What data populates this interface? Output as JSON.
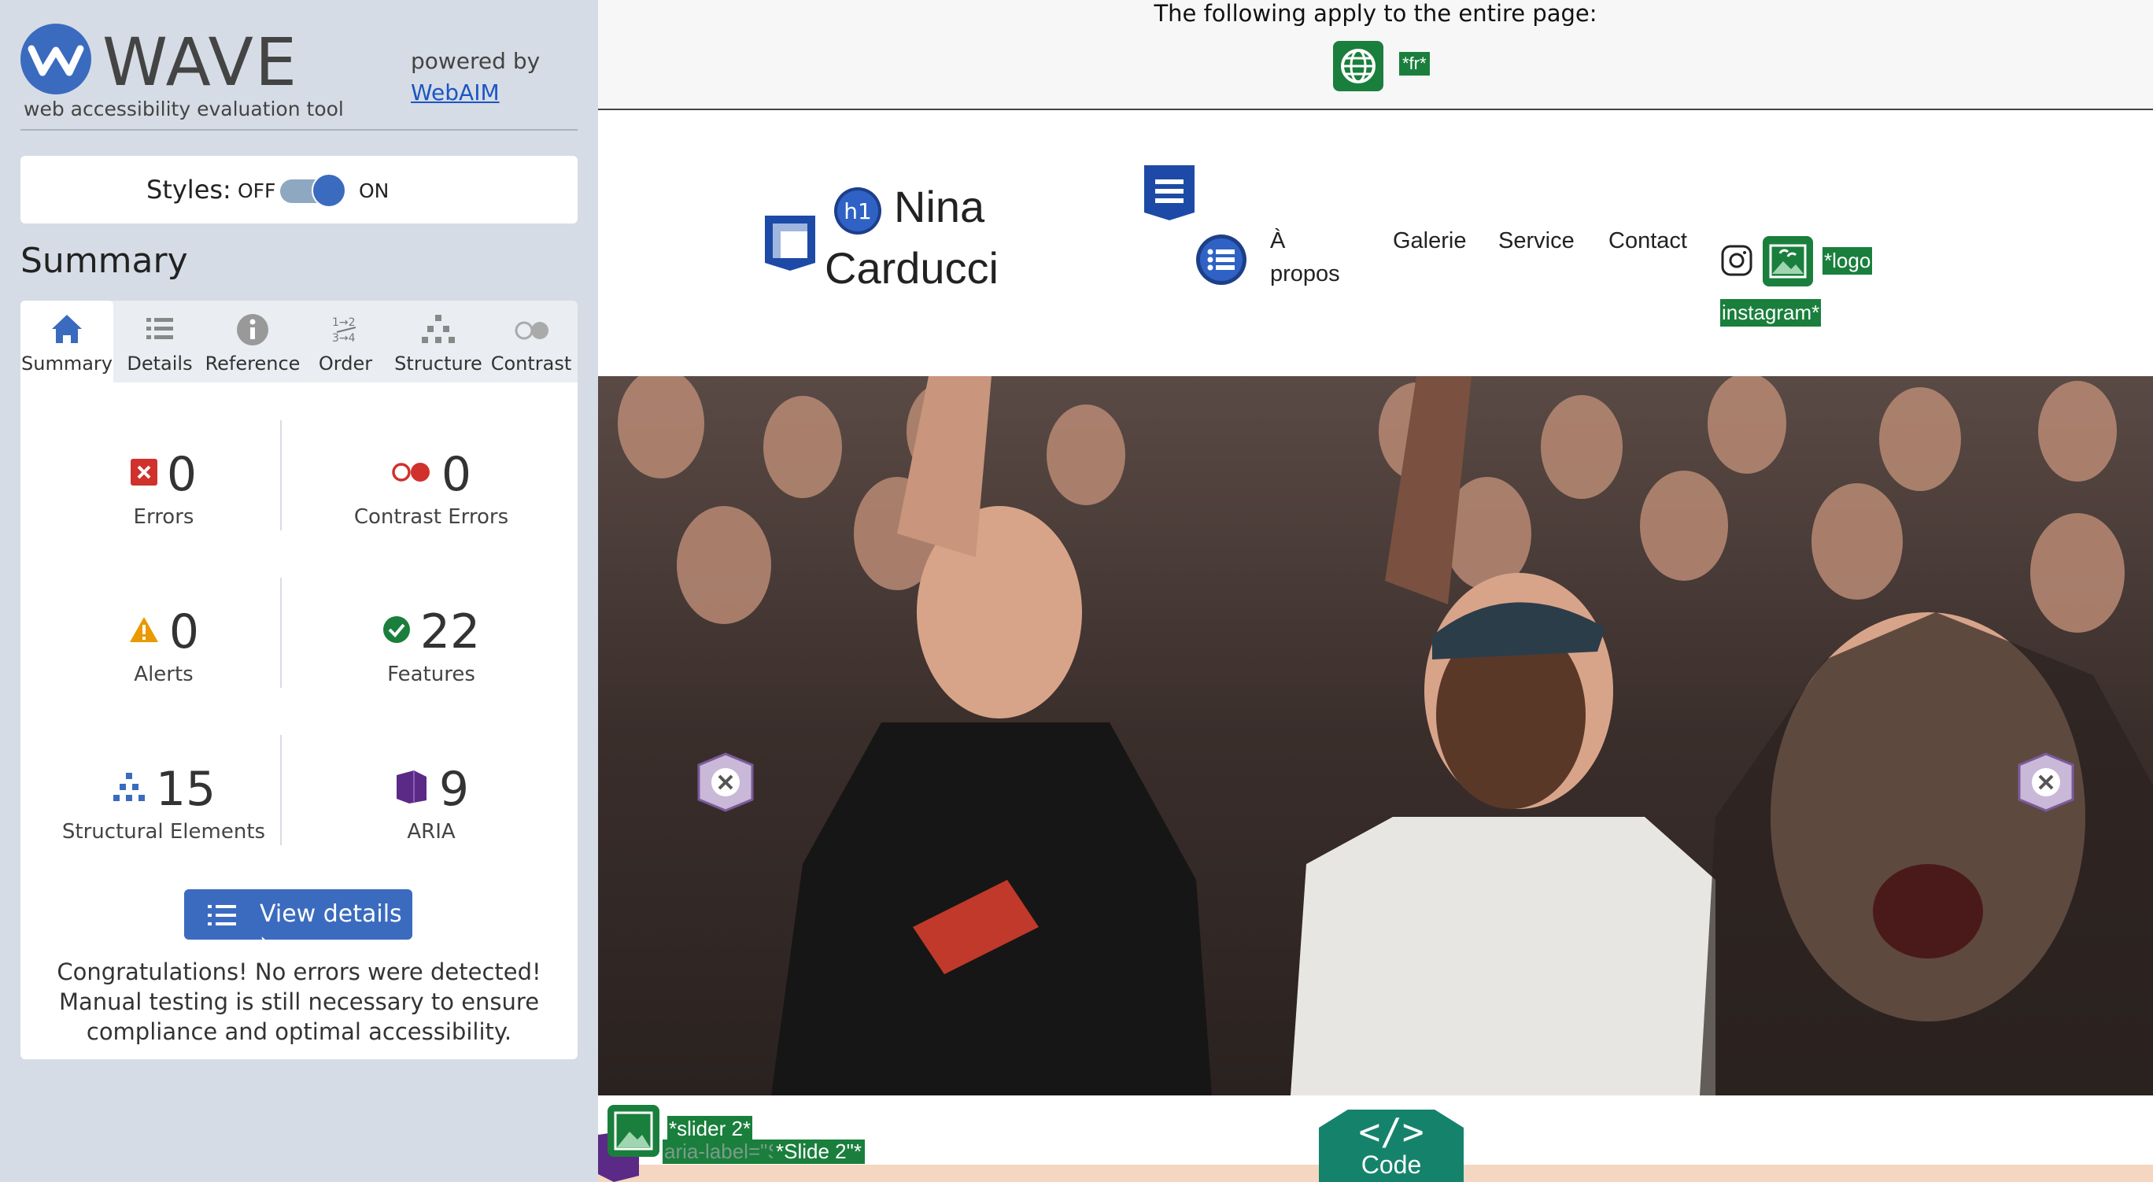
{
  "wave": {
    "logo_text": "WAVE",
    "logo_sub": "web accessibility evaluation tool",
    "powered_by": "powered by",
    "webaim_link": "WebAIM",
    "styles_label": "Styles:",
    "styles_off": "OFF",
    "styles_on": "ON",
    "styles_enabled": true,
    "summary_heading": "Summary",
    "tabs": [
      {
        "label": "Summary",
        "icon": "home-icon",
        "active": true
      },
      {
        "label": "Details",
        "icon": "list-icon"
      },
      {
        "label": "Reference",
        "icon": "info-icon"
      },
      {
        "label": "Order",
        "icon": "order-icon"
      },
      {
        "label": "Structure",
        "icon": "structure-icon"
      },
      {
        "label": "Contrast",
        "icon": "contrast-icon"
      }
    ],
    "stats": {
      "errors": {
        "value": "0",
        "label": "Errors"
      },
      "contrast_errors": {
        "value": "0",
        "label": "Contrast Errors"
      },
      "alerts": {
        "value": "0",
        "label": "Alerts"
      },
      "features": {
        "value": "22",
        "label": "Features"
      },
      "structural": {
        "value": "15",
        "label": "Structural Elements"
      },
      "aria": {
        "value": "9",
        "label": "ARIA"
      }
    },
    "view_details": "View details ›",
    "congrats": "Congratulations! No errors were detected! Manual testing is still necessary to ensure compliance and optimal accessibility."
  },
  "page": {
    "banner_text": "The following apply to the entire page:",
    "lang_tag": "*fr*",
    "h1_badge": "h1",
    "title_line1": "Nina",
    "title_line2": "Carducci",
    "nav": [
      "À",
      "propos",
      "Galerie",
      "Service",
      "Contact"
    ],
    "logo_tag_1": "*logo",
    "logo_tag_2": "instagram*",
    "slider_tag": "*slider 2*",
    "slide_tag_back": "aria-label=\"Slide 3\"",
    "slide_tag": "*Slide 2\"*",
    "code_label": "Code",
    "code_glyph": "</>"
  },
  "colors": {
    "wave_blue": "#3b6bbf",
    "sidebar_bg": "#d5dce5",
    "feature_green": "#1a7f3c",
    "error_red": "#d0312d",
    "alert_orange": "#e89a00",
    "aria_purple": "#5b2a86",
    "code_teal": "#15836b"
  }
}
